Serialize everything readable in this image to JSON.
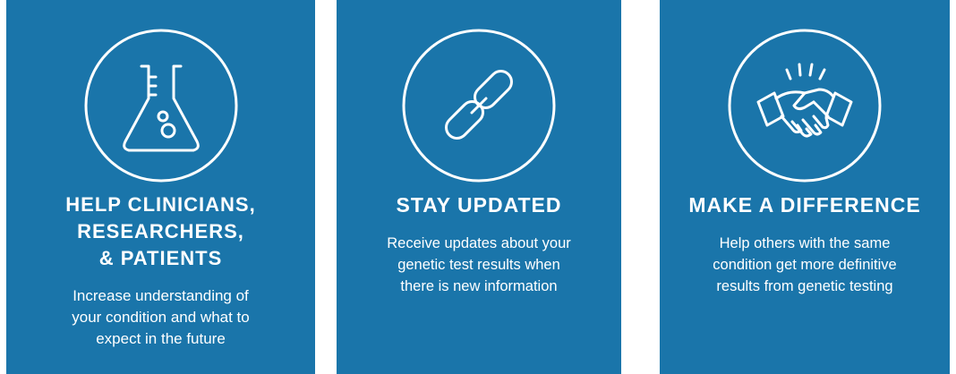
{
  "cards": [
    {
      "icon": "flask-icon",
      "heading": "HELP CLINICIANS,\nRESEARCHERS,\n& PATIENTS",
      "description": "Increase understanding of\nyour condition and what to\nexpect in the future"
    },
    {
      "icon": "chain-link-icon",
      "heading": "STAY UPDATED",
      "description": "Receive updates about your\ngenetic test results when\nthere is new information"
    },
    {
      "icon": "handshake-icon",
      "heading": "MAKE A DIFFERENCE",
      "description": "Help others with the same\ncondition get more definitive\nresults from genetic testing"
    }
  ],
  "colors": {
    "card_background": "#1a75aa",
    "foreground": "#ffffff"
  }
}
